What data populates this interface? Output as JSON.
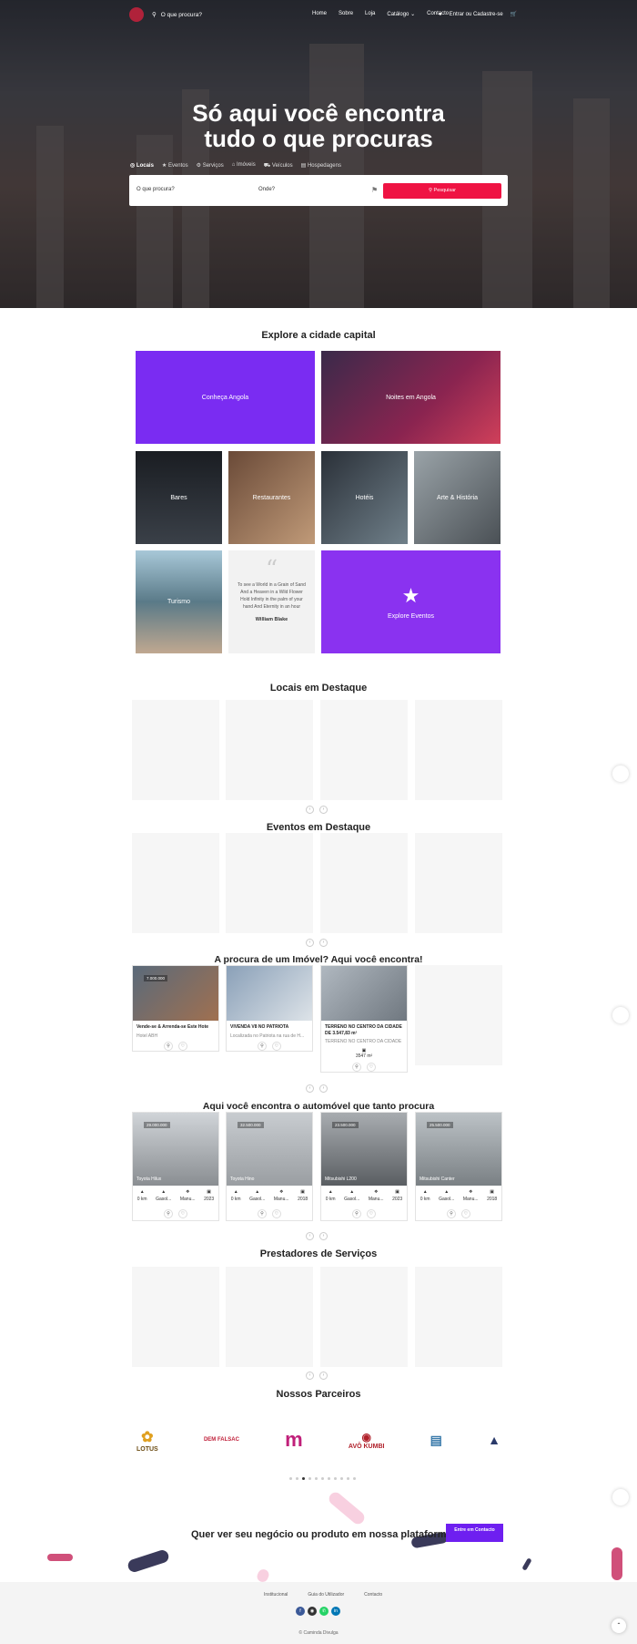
{
  "nav": {
    "search_placeholder": "O que procura?",
    "links": [
      "Home",
      "Sobre",
      "Loja",
      "Catálogo",
      "Contacto"
    ],
    "login": "Entrar ou Cadastre-se"
  },
  "hero": {
    "title_line1": "Só aqui você encontra",
    "title_line2": "tudo o que procuras",
    "categories": [
      "Locais",
      "Eventos",
      "Serviços",
      "Imóveis",
      "Veículos",
      "Hospedagens"
    ],
    "what_placeholder": "O que procura?",
    "where_placeholder": "Onde?",
    "search_button": "Pesquisar"
  },
  "explore": {
    "title": "Explore a cidade capital",
    "tiles": [
      "Conheça Angola",
      "Noites em Angola",
      "Bares",
      "Restaurantes",
      "Hotéis",
      "Arte & História",
      "Turismo",
      "Explore Eventos"
    ],
    "quote": "To see a World in a Grain of Sand And a Heaven in a Wild Flower Hold Infinity in the palm of your hand And Eternity in an hour",
    "quote_author": "William Blake"
  },
  "sections": {
    "locais": "Locais em Destaque",
    "eventos": "Eventos em Destaque",
    "imoveis": "A procura de um Imóvel? Aqui você encontra!",
    "autos": "Aqui você encontra o automóvel que tanto procura",
    "servicos": "Prestadores de Serviços",
    "parceiros": "Nossos Parceiros"
  },
  "properties": [
    {
      "price": "7.000.000",
      "title": "Vende-se & Arrenda-se Este Hote",
      "sub": "Hotel ABH"
    },
    {
      "price": "",
      "title": "VIVENDA V8 NO PATRIOTA",
      "sub": "Localizada no Patriota na rua de H..."
    },
    {
      "price": "",
      "title": "TERRENO NO CENTRO DA CIDADE DE 3.547,83 m²",
      "sub": "TERRENO NO CENTRO DA CIDADE",
      "area": "3547 m²"
    }
  ],
  "vehicles": [
    {
      "price": "29.000.000",
      "name": "Toyota Hilux",
      "km": "0 km",
      "fuel": "Gasol...",
      "gear": "Manu...",
      "year": "2023"
    },
    {
      "price": "32.500.000",
      "name": "Toyota Hino",
      "km": "0 km",
      "fuel": "Gasol...",
      "gear": "Manu...",
      "year": "2018"
    },
    {
      "price": "23.500.000",
      "name": "Mitsubishi L200",
      "km": "0 km",
      "fuel": "Gasol...",
      "gear": "Manu...",
      "year": "2023"
    },
    {
      "price": "25.500.000",
      "name": "Mitsubishi Canter",
      "km": "0 km",
      "fuel": "Gasol...",
      "gear": "Manu...",
      "year": "2018"
    }
  ],
  "partners": [
    "LOTUS",
    "DEM FALSAC",
    "",
    "AVÔ KUMBI",
    "",
    ""
  ],
  "cta": {
    "text": "Quer ver seu negócio ou produto em nossa plataforma?",
    "button": "Entre em Contacto"
  },
  "footer": {
    "links": [
      "Institucional",
      "Guia do Utilizador",
      "Contacto"
    ],
    "copyright": "© Caminda Divulga"
  },
  "colors": {
    "accent": "#6e1ff0",
    "search": "#ef1343"
  }
}
